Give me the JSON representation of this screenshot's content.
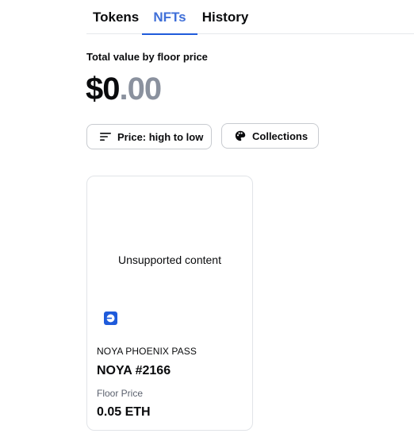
{
  "tabs": [
    {
      "label": "Tokens",
      "active": false
    },
    {
      "label": "NFTs",
      "active": true
    },
    {
      "label": "History",
      "active": false
    }
  ],
  "total": {
    "label": "Total value by floor price",
    "whole": "$0",
    "cents": ".00"
  },
  "filters": {
    "sort_label": "Price: high to low",
    "sort_icon": "sort-lines-icon",
    "collections_label": "Collections",
    "collections_icon": "palette-icon"
  },
  "nft": {
    "media_text": "Unsupported content",
    "chain_icon": "base-chain-icon",
    "collection": "NOYA PHOENIX PASS",
    "name": "NOYA #2166",
    "floor_label": "Floor Price",
    "floor_value": "0.05 ETH"
  },
  "colors": {
    "accent": "#1f5bdb",
    "active_tab_text": "#3f6fd8",
    "muted": "#8a919e",
    "border": "#c8cbd0"
  }
}
